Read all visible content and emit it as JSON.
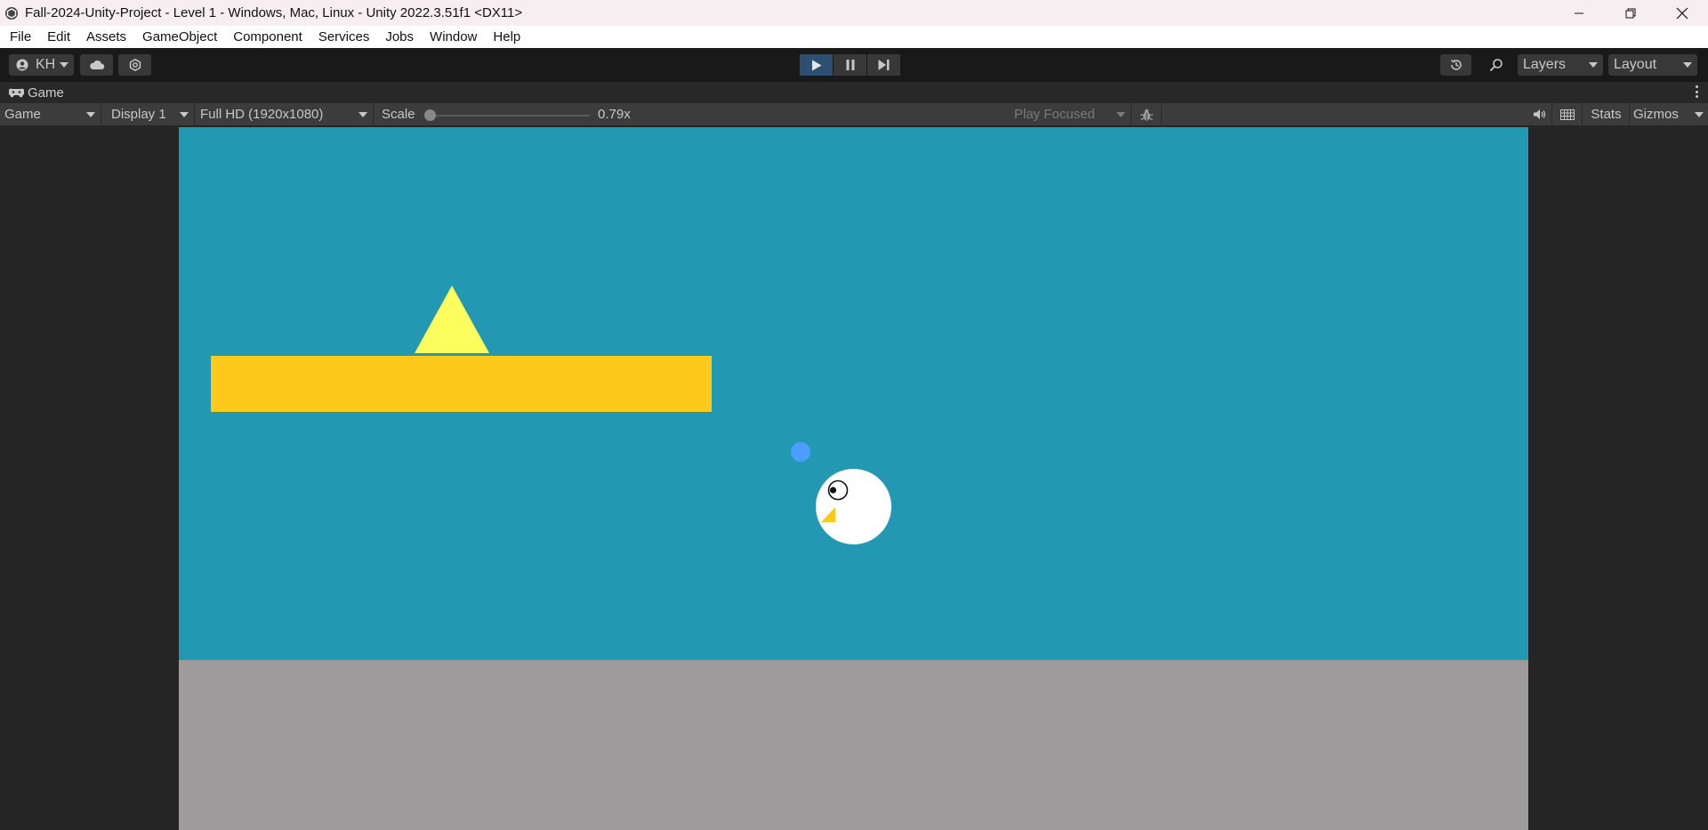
{
  "window": {
    "title": "Fall-2024-Unity-Project - Level 1 - Windows, Mac, Linux - Unity 2022.3.51f1 <DX11>"
  },
  "menu": [
    "File",
    "Edit",
    "Assets",
    "GameObject",
    "Component",
    "Services",
    "Jobs",
    "Window",
    "Help"
  ],
  "toolbar": {
    "account_label": "KH",
    "layers_label": "Layers",
    "layout_label": "Layout",
    "play_state": "playing"
  },
  "tab": {
    "label": "Game"
  },
  "gamebar": {
    "mode": "Game",
    "display": "Display 1",
    "resolution": "Full HD (1920x1080)",
    "scale_label": "Scale",
    "scale_value": "0.79x",
    "scale_fraction": 0.0,
    "play_focused": "Play Focused",
    "stats": "Stats",
    "gizmos": "Gizmos"
  },
  "colors": {
    "sky": "#2298b3",
    "ground": "#9e9b9c",
    "platform": "#fdc91a",
    "spike": "#fdfd5e",
    "bird": "#ffffff",
    "beak": "#fdc91a",
    "projectile": "#4e9ffd",
    "play_active": "#2d4f72"
  },
  "icons": [
    "unity-logo-icon",
    "account-icon",
    "cloud-icon",
    "settings-icon",
    "play-icon",
    "pause-icon",
    "step-icon",
    "history-icon",
    "search-icon",
    "gamepad-icon",
    "mute-icon",
    "grid-icon",
    "bug-icon",
    "kebab-icon"
  ]
}
